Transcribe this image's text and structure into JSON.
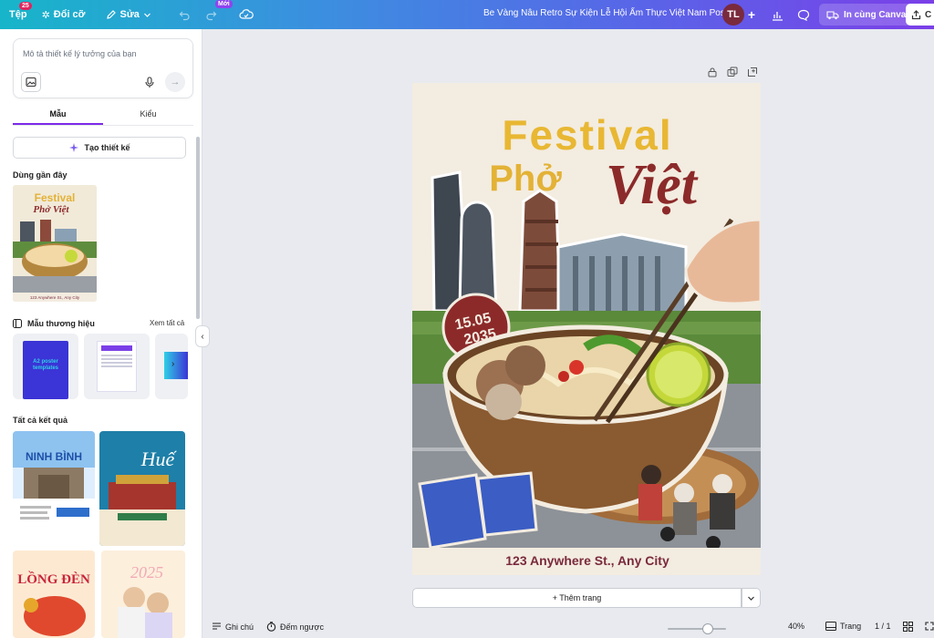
{
  "topbar": {
    "file_label": "Tệp",
    "file_badge": "25",
    "resize_label": "Đổi cỡ",
    "edit_label": "Sửa",
    "new_badge": "Mới",
    "design_title": "Be Vàng Nâu Retro Sự Kiện Lễ Hội Ẩm Thực Việt Nam Poster",
    "avatar_initials": "TL",
    "print_label": "In cùng Canva",
    "share_label": "C"
  },
  "sidebar": {
    "prompt_placeholder": "Mô tả thiết kế lý tưởng của bạn",
    "tabs": [
      {
        "label": "Mẫu",
        "active": true
      },
      {
        "label": "Kiểu",
        "active": false
      }
    ],
    "create_label": "Tạo thiết kế",
    "recent_title": "Dùng gần đây",
    "brand_title": "Mẫu thương hiệu",
    "see_all": "Xem tất cả",
    "brand_card_text": "A2 poster templates",
    "all_results_title": "Tất cả kết quả",
    "results": [
      {
        "name": "NINH BÌNH"
      },
      {
        "name": "Huế"
      },
      {
        "name": "LỒNG ĐÈN"
      },
      {
        "name": "2025"
      }
    ],
    "recent_thumb": {
      "line1": "Festival",
      "line2": "Phở Việt",
      "address": "123 Anywhere St., Any City"
    }
  },
  "poster": {
    "title_line1": "Festival",
    "title_pho": "Phở",
    "title_viet": "Việt",
    "date_line1": "15.05",
    "date_line2": "2035",
    "address": "123 Anywhere St., Any City",
    "colors": {
      "gold": "#e8b733",
      "maroon": "#8c2a2a",
      "background": "#f3ece0"
    }
  },
  "canvas": {
    "add_page_label": "+ Thêm trang"
  },
  "bottombar": {
    "notes_label": "Ghi chú",
    "timer_label": "Đếm ngược",
    "zoom_percent": "40%",
    "zoom_level": 0.4,
    "pages_label": "Trang",
    "page_count": "1 / 1"
  }
}
